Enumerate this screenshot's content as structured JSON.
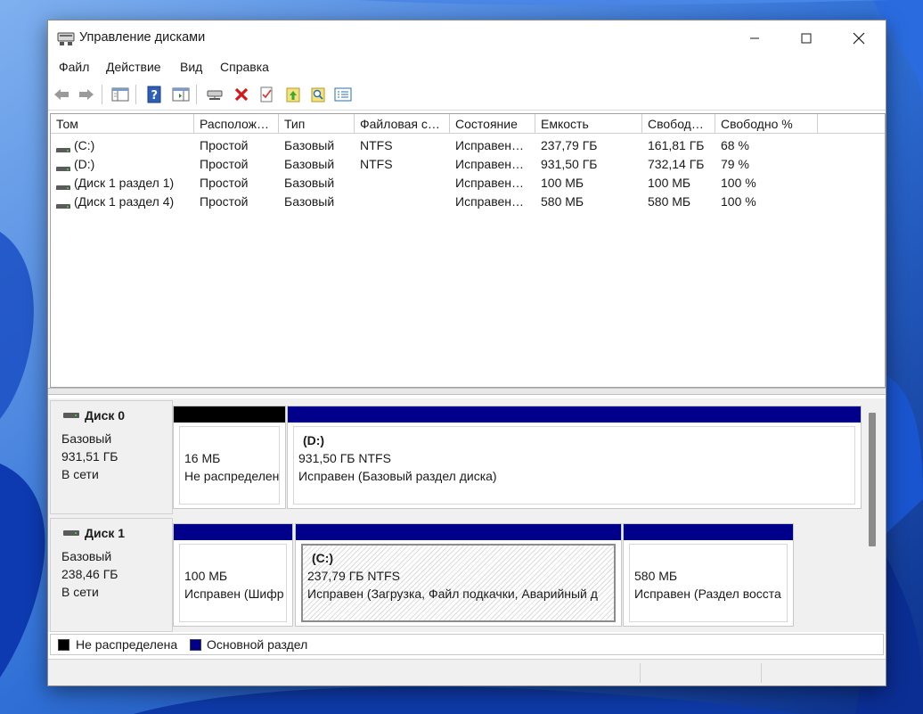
{
  "window": {
    "title": "Управление дисками",
    "minimize": "minimize",
    "maximize": "maximize",
    "close": "close"
  },
  "menu": [
    "Файл",
    "Действие",
    "Вид",
    "Справка"
  ],
  "toolbar": {
    "icons": [
      "back-icon",
      "forward-icon",
      "console-tree-icon",
      "help-icon",
      "show-hide-action-pane-icon",
      "connect-drive-icon",
      "delete-icon",
      "properties-icon",
      "up-level-icon",
      "search-icon",
      "export-list-icon"
    ]
  },
  "volume_table": {
    "columns": [
      "Том",
      "Располож…",
      "Тип",
      "Файловая с…",
      "Состояние",
      "Емкость",
      "Свобод…",
      "Свободно %"
    ],
    "rows": [
      [
        "(C:)",
        "Простой",
        "Базовый",
        "NTFS",
        "Исправен…",
        "237,79 ГБ",
        "161,81 ГБ",
        "68 %"
      ],
      [
        "(D:)",
        "Простой",
        "Базовый",
        "NTFS",
        "Исправен…",
        "931,50 ГБ",
        "732,14 ГБ",
        "79 %"
      ],
      [
        "(Диск 1 раздел 1)",
        "Простой",
        "Базовый",
        "",
        "Исправен…",
        "100 МБ",
        "100 МБ",
        "100 %"
      ],
      [
        "(Диск 1 раздел 4)",
        "Простой",
        "Базовый",
        "",
        "Исправен…",
        "580 МБ",
        "580 МБ",
        "100 %"
      ]
    ]
  },
  "disks": [
    {
      "name": "Диск 0",
      "type": "Базовый",
      "size": "931,51 ГБ",
      "status": "В сети",
      "partitions": [
        {
          "title": "",
          "size": "16 МБ",
          "state": "Не распределен",
          "bar_color": "#000000"
        },
        {
          "title": "(D:)",
          "size": "931,50 ГБ NTFS",
          "state": "Исправен (Базовый раздел диска)",
          "bar_color": "#00008b"
        }
      ]
    },
    {
      "name": "Диск 1",
      "type": "Базовый",
      "size": "238,46 ГБ",
      "status": "В сети",
      "partitions": [
        {
          "title": "",
          "size": "100 МБ",
          "state": "Исправен (Шифр",
          "bar_color": "#00008b"
        },
        {
          "title": "(C:)",
          "size": "237,79 ГБ NTFS",
          "state": "Исправен (Загрузка, Файл подкачки, Аварийный д",
          "bar_color": "#00008b"
        },
        {
          "title": "",
          "size": "580 МБ",
          "state": "Исправен (Раздел восста",
          "bar_color": "#00008b"
        }
      ]
    }
  ],
  "legend": [
    {
      "label": "Не распределена",
      "color": "#000000"
    },
    {
      "label": "Основной раздел",
      "color": "#00008b"
    }
  ]
}
